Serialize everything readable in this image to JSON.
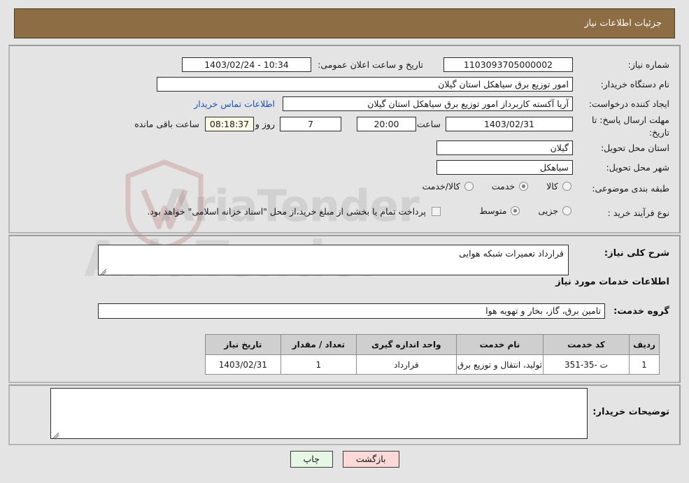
{
  "header": {
    "title": "جزئیات اطلاعات نیاز"
  },
  "watermark": {
    "text_a": "AriaTender",
    "text_b": ".net"
  },
  "need_info": {
    "need_number_label": "شماره نیاز:",
    "need_number_value": "1103093705000002",
    "announce_datetime_label": "تاریخ و ساعت اعلان عمومی:",
    "announce_datetime_value": "1403/02/24 - 10:34",
    "buyer_org_label": "نام دستگاه خریدار:",
    "buyer_org_value": "امور توزیع برق سیاهکل استان گیلان",
    "requester_label": "ایجاد کننده درخواست:",
    "requester_value": "آریا آکسته کاربرداز امور توزیع برق سیاهکل استان گیلان",
    "contact_link": "اطلاعات تماس خریدار",
    "deadline_label": "مهلت ارسال پاسخ: تا تاریخ:",
    "deadline_date": "1403/02/31",
    "deadline_hour_label": "ساعت",
    "deadline_hour": "20:00",
    "days_left": "7",
    "days_unit": "روز و",
    "time_left": "08:18:37",
    "time_left_suffix": "ساعت باقی مانده",
    "province_label": "استان محل تحویل:",
    "province_value": "گیلان",
    "city_label": "شهر محل تحویل:",
    "city_value": "سیاهکل"
  },
  "classification": {
    "label": "طبقه بندی موضوعی:",
    "options": [
      {
        "label": "کالا",
        "selected": false
      },
      {
        "label": "خدمت",
        "selected": true
      },
      {
        "label": "کالا/خدمت",
        "selected": false
      }
    ]
  },
  "process_type": {
    "label": "نوع فرآیند خرید :",
    "options": [
      {
        "label": "جزیی",
        "selected": false
      },
      {
        "label": "متوسط",
        "selected": true
      }
    ],
    "checkbox_note": "پرداخت تمام یا بخشی از مبلغ خرید،از محل \"اسناد خزانه اسلامی\" خواهد بود.",
    "checkbox_checked": false
  },
  "summary": {
    "label": "شرح کلی نیاز:",
    "value": "قرارداد تعمیرات شبکه هوایی"
  },
  "services_section": {
    "heading": "اطلاعات خدمات مورد نیاز",
    "group_label": "گروه خدمت:",
    "group_value": "تامین برق، گاز، بخار و تهویه هوا"
  },
  "table": {
    "columns": [
      "ردیف",
      "کد خدمت",
      "نام خدمت",
      "واحد اندازه گیری",
      "تعداد / مقدار",
      "تاریخ نیاز"
    ],
    "rows": [
      {
        "index": "1",
        "code": "ت -35-351",
        "name": "تولید، انتقال و توزیع برق",
        "unit": "قرارداد",
        "quantity": "1",
        "need_date": "1403/02/31"
      }
    ]
  },
  "buyer_notes": {
    "label": "توضیحات خریدار:",
    "value": ""
  },
  "footer": {
    "back_label": "بازگشت",
    "print_label": "چاپ"
  },
  "colors": {
    "header_bg": "#8c6d44",
    "page_bg": "#e4e4e4",
    "link": "#1652c6",
    "table_header_bg": "#cfcfcf",
    "back_btn_bg": "#fbd9d9",
    "print_btn_bg": "#e6f7e6",
    "timer_bg": "#fbfbe8"
  }
}
